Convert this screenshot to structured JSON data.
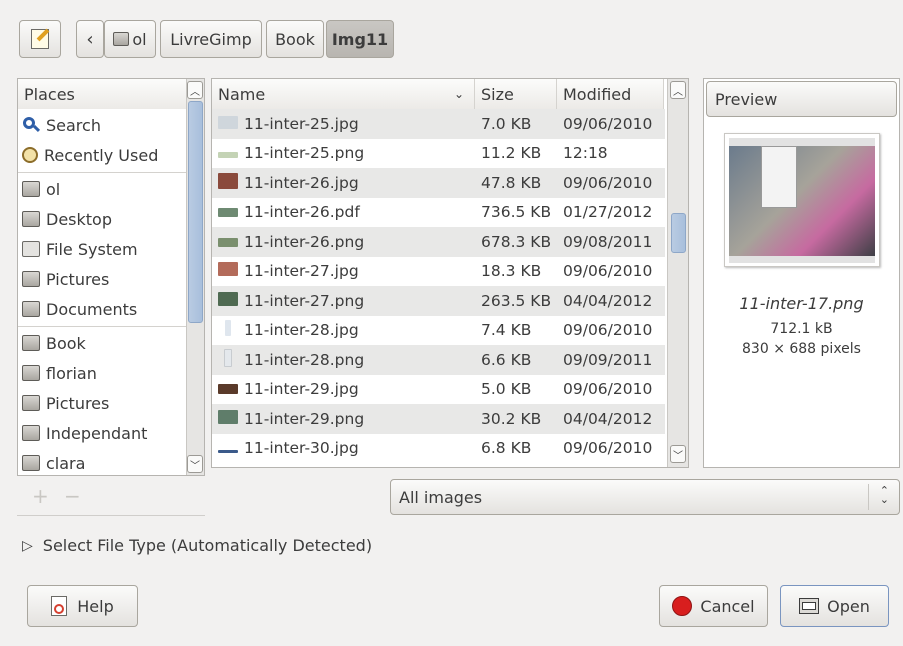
{
  "toolbar": {
    "breadcrumbs": [
      "ol",
      "LivreGimp",
      "Book",
      "Img11"
    ],
    "back_glyph": "‹"
  },
  "places": {
    "header": "Places",
    "items": [
      {
        "label": "Search",
        "icon": "search-icon"
      },
      {
        "label": "Recently Used",
        "icon": "clock-icon"
      },
      {
        "label": "ol",
        "icon": "home-folder-icon"
      },
      {
        "label": "Desktop",
        "icon": "desktop-folder-icon"
      },
      {
        "label": "File System",
        "icon": "harddisk-icon"
      },
      {
        "label": "Pictures",
        "icon": "pictures-folder-icon"
      },
      {
        "label": "Documents",
        "icon": "documents-folder-icon"
      },
      {
        "label": "Book",
        "icon": "folder-icon"
      },
      {
        "label": "florian",
        "icon": "folder-icon"
      },
      {
        "label": "Pictures",
        "icon": "folder-icon"
      },
      {
        "label": "Independant",
        "icon": "folder-icon"
      },
      {
        "label": "clara",
        "icon": "folder-icon"
      }
    ],
    "add_glyph": "+",
    "remove_glyph": "−"
  },
  "files": {
    "columns": {
      "name": "Name",
      "size": "Size",
      "modified": "Modified"
    },
    "rows": [
      {
        "name": "11-inter-25.jpg",
        "size": "7.0 KB",
        "modified": "09/06/2010",
        "thumb": "#cfd6dc"
      },
      {
        "name": "11-inter-25.png",
        "size": "11.2 KB",
        "modified": "12:18",
        "thumb": "#c4d3b5"
      },
      {
        "name": "11-inter-26.jpg",
        "size": "47.8 KB",
        "modified": "09/06/2010",
        "thumb": "#8a4a3c"
      },
      {
        "name": "11-inter-26.pdf",
        "size": "736.5 KB",
        "modified": "01/27/2012",
        "thumb": "#6e8a72"
      },
      {
        "name": "11-inter-26.png",
        "size": "678.3 KB",
        "modified": "09/08/2011",
        "thumb": "#7a8f6e"
      },
      {
        "name": "11-inter-27.jpg",
        "size": "18.3 KB",
        "modified": "09/06/2010",
        "thumb": "#b36b5a"
      },
      {
        "name": "11-inter-27.png",
        "size": "263.5 KB",
        "modified": "04/04/2012",
        "thumb": "#4f6a52"
      },
      {
        "name": "11-inter-28.jpg",
        "size": "7.4 KB",
        "modified": "09/06/2010",
        "thumb": "#dfe6ee"
      },
      {
        "name": "11-inter-28.png",
        "size": "6.6 KB",
        "modified": "09/09/2011",
        "thumb": "#e4e8ec"
      },
      {
        "name": "11-inter-29.jpg",
        "size": "5.0 KB",
        "modified": "09/06/2010",
        "thumb": "#5a3a2a"
      },
      {
        "name": "11-inter-29.png",
        "size": "30.2 KB",
        "modified": "04/04/2012",
        "thumb": "#5f7d6a"
      },
      {
        "name": "11-inter-30.jpg",
        "size": "6.8 KB",
        "modified": "09/06/2010",
        "thumb": "#3b5a8a"
      }
    ]
  },
  "preview": {
    "button_label": "Preview",
    "filename": "11-inter-17.png",
    "filesize": "712.1 kB",
    "dimensions": "830 × 688 pixels"
  },
  "filter": {
    "selected": "All images",
    "arrow_glyph": "⌃⌄"
  },
  "filetype": {
    "expander_label": "Select File Type (Automatically Detected)",
    "expander_glyph": "▷"
  },
  "actions": {
    "help_label": "Help",
    "cancel_label": "Cancel",
    "open_label": "Open"
  }
}
